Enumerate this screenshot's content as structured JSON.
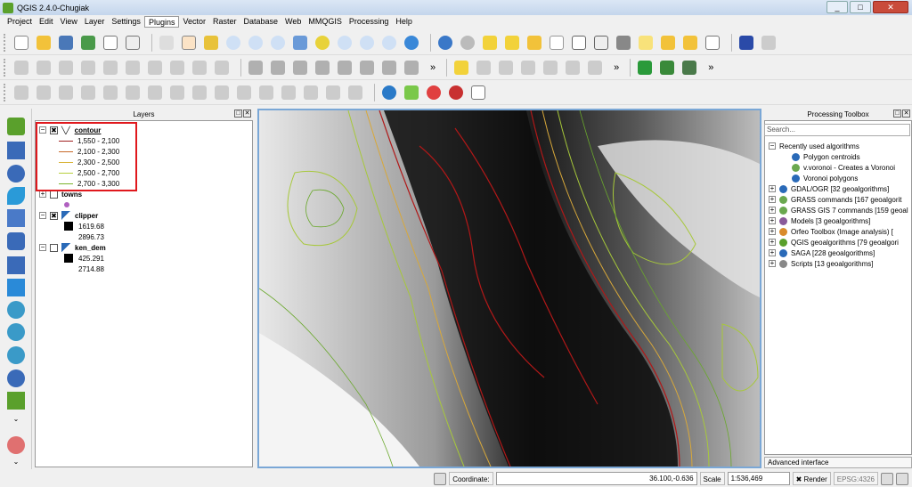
{
  "window": {
    "title": "QGIS 2.4.0-Chugiak",
    "minimize": "_",
    "maximize": "□",
    "close": "✕"
  },
  "menu": [
    "Project",
    "Edit",
    "View",
    "Layer",
    "Settings",
    "Plugins",
    "Vector",
    "Raster",
    "Database",
    "Web",
    "MMQGIS",
    "Processing",
    "Help"
  ],
  "layers_panel": {
    "title": "Layers",
    "float_btn": "□",
    "close_btn": "✕",
    "layers": [
      {
        "name": "contour",
        "checked": true,
        "expanded": true,
        "legend": [
          {
            "label": "1,550 - 2,100",
            "color": "#a02020"
          },
          {
            "label": "2,100 - 2,300",
            "color": "#c86a2a"
          },
          {
            "label": "2,300 - 2,500",
            "color": "#d9b43a"
          },
          {
            "label": "2,500 - 2,700",
            "color": "#b7cf3d"
          },
          {
            "label": "2,700 - 3,300",
            "color": "#7bb32c"
          }
        ]
      },
      {
        "name": "towns",
        "checked": false,
        "expanded": false
      },
      {
        "name": "clipper",
        "checked": true,
        "expanded": true,
        "legend": [
          {
            "label": "1619.68"
          },
          {
            "label": "2896.73"
          }
        ]
      },
      {
        "name": "ken_dem",
        "checked": false,
        "expanded": true,
        "legend": [
          {
            "label": "425.291"
          },
          {
            "label": "2714.88"
          }
        ]
      }
    ],
    "expand_open": "−",
    "expand_closed": "+",
    "check_mark": "✖"
  },
  "toolbox": {
    "title": "Processing Toolbox",
    "float_btn": "□",
    "close_btn": "✕",
    "search_placeholder": "Search...",
    "recent": {
      "label": "Recently used algorithms",
      "items": [
        "Polygon centroids",
        "v.voronoi - Creates a Voronoi",
        "Voronoi polygons"
      ]
    },
    "groups": [
      {
        "label": "GDAL/OGR [32 geoalgorithms]",
        "color": "#2a6ab8"
      },
      {
        "label": "GRASS commands [167 geoalgorit",
        "color": "#6aa84f"
      },
      {
        "label": "GRASS GIS 7 commands [159 geoal",
        "color": "#6aa84f"
      },
      {
        "label": "Models [3 geoalgorithms]",
        "color": "#8a5a9a"
      },
      {
        "label": "Orfeo Toolbox (Image analysis) [",
        "color": "#d98b2b"
      },
      {
        "label": "QGIS geoalgorithms [79 geoalgori",
        "color": "#5aa02c"
      },
      {
        "label": "SAGA [228 geoalgorithms]",
        "color": "#2a6ab8"
      },
      {
        "label": "Scripts [13 geoalgorithms]",
        "color": "#888888"
      }
    ],
    "advanced": "Advanced interface"
  },
  "statusbar": {
    "coordinate_label": "Coordinate:",
    "coordinate_value": "36.100,-0.636",
    "scale_label": "Scale",
    "scale_value": "1:536,469",
    "render_label": "Render",
    "render_check": "✖",
    "epsg": "EPSG:4326"
  },
  "toolbar_more": "»"
}
